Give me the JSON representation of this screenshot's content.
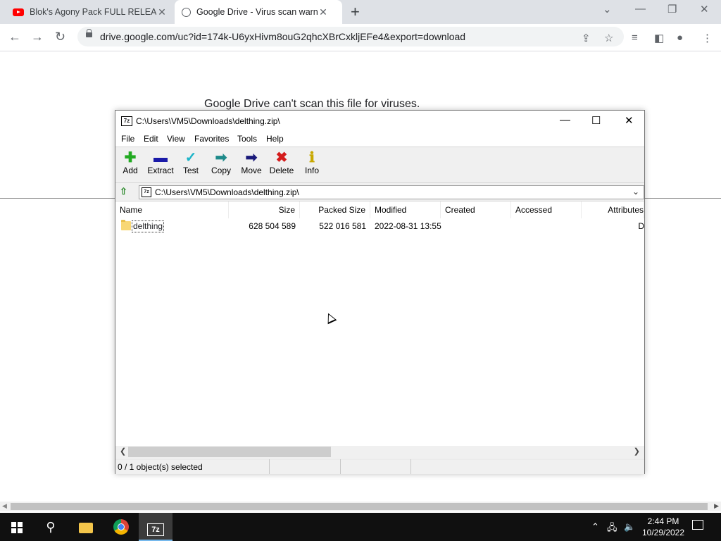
{
  "browser": {
    "tabs": [
      {
        "title": "Blok's Agony Pack FULL RELEASE",
        "icon": "youtube-icon"
      },
      {
        "title": "Google Drive - Virus scan warning",
        "icon": "globe-icon"
      }
    ],
    "url": "drive.google.com/uc?id=174k-U6yxHivm8ouG2qhcXBrCxkljEFe4&export=download"
  },
  "page": {
    "warning_text": "Google Drive can't scan this file for viruses."
  },
  "sevenzip": {
    "title": "C:\\Users\\VM5\\Downloads\\delthing.zip\\",
    "menu": [
      "File",
      "Edit",
      "View",
      "Favorites",
      "Tools",
      "Help"
    ],
    "toolbar": [
      {
        "label": "Add",
        "icon": "add-icon",
        "color": "#22aa22"
      },
      {
        "label": "Extract",
        "icon": "extract-icon",
        "color": "#1a1aa8"
      },
      {
        "label": "Test",
        "icon": "test-icon",
        "color": "#1cb4c8"
      },
      {
        "label": "Copy",
        "icon": "copy-icon",
        "color": "#1e8a8a"
      },
      {
        "label": "Move",
        "icon": "move-icon",
        "color": "#1a1a7a"
      },
      {
        "label": "Delete",
        "icon": "delete-icon",
        "color": "#d41c1c"
      },
      {
        "label": "Info",
        "icon": "info-icon",
        "color": "#c8a800"
      }
    ],
    "address": "C:\\Users\\VM5\\Downloads\\delthing.zip\\",
    "columns": [
      "Name",
      "Size",
      "Packed Size",
      "Modified",
      "Created",
      "Accessed",
      "Attributes"
    ],
    "rows": [
      {
        "name": "delthing",
        "size": "628 504 589",
        "packed": "522 016 581",
        "modified": "2022-08-31 13:55",
        "created": "",
        "accessed": "",
        "attributes": "D"
      }
    ],
    "status": "0 / 1 object(s) selected"
  },
  "taskbar": {
    "time": "2:44 PM",
    "date": "10/29/2022"
  }
}
